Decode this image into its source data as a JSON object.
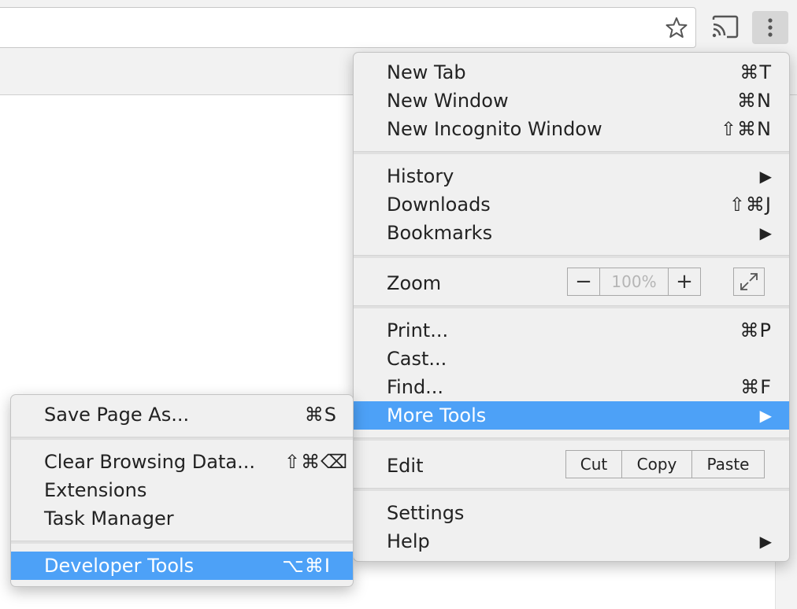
{
  "toolbar": {
    "icons": {
      "bookmark": "star-icon",
      "cast": "cast-icon",
      "menu": "kebab-menu-icon"
    }
  },
  "main_menu": {
    "new_tab": {
      "label": "New Tab",
      "shortcut": "⌘T"
    },
    "new_window": {
      "label": "New Window",
      "shortcut": "⌘N"
    },
    "new_incognito": {
      "label": "New Incognito Window",
      "shortcut": "⇧⌘N"
    },
    "history": {
      "label": "History",
      "arrow": "▶"
    },
    "downloads": {
      "label": "Downloads",
      "shortcut": "⇧⌘J"
    },
    "bookmarks": {
      "label": "Bookmarks",
      "arrow": "▶"
    },
    "zoom": {
      "label": "Zoom",
      "minus": "−",
      "value": "100%",
      "plus": "+"
    },
    "print": {
      "label": "Print...",
      "shortcut": "⌘P"
    },
    "cast": {
      "label": "Cast..."
    },
    "find": {
      "label": "Find...",
      "shortcut": "⌘F"
    },
    "more_tools": {
      "label": "More Tools",
      "arrow": "▶"
    },
    "edit": {
      "label": "Edit",
      "cut": "Cut",
      "copy": "Copy",
      "paste": "Paste"
    },
    "settings": {
      "label": "Settings"
    },
    "help": {
      "label": "Help",
      "arrow": "▶"
    }
  },
  "sub_menu": {
    "save_page": {
      "label": "Save Page As...",
      "shortcut": "⌘S"
    },
    "clear_data": {
      "label": "Clear Browsing Data...",
      "shortcut": "⇧⌘⌫"
    },
    "extensions": {
      "label": "Extensions"
    },
    "task_manager": {
      "label": "Task Manager"
    },
    "developer_tools": {
      "label": "Developer Tools",
      "shortcut": "⌥⌘I"
    }
  },
  "colors": {
    "highlight": "#4da1f7",
    "menu_bg": "#f0f0f0",
    "chrome_bg": "#f2f2f2"
  }
}
